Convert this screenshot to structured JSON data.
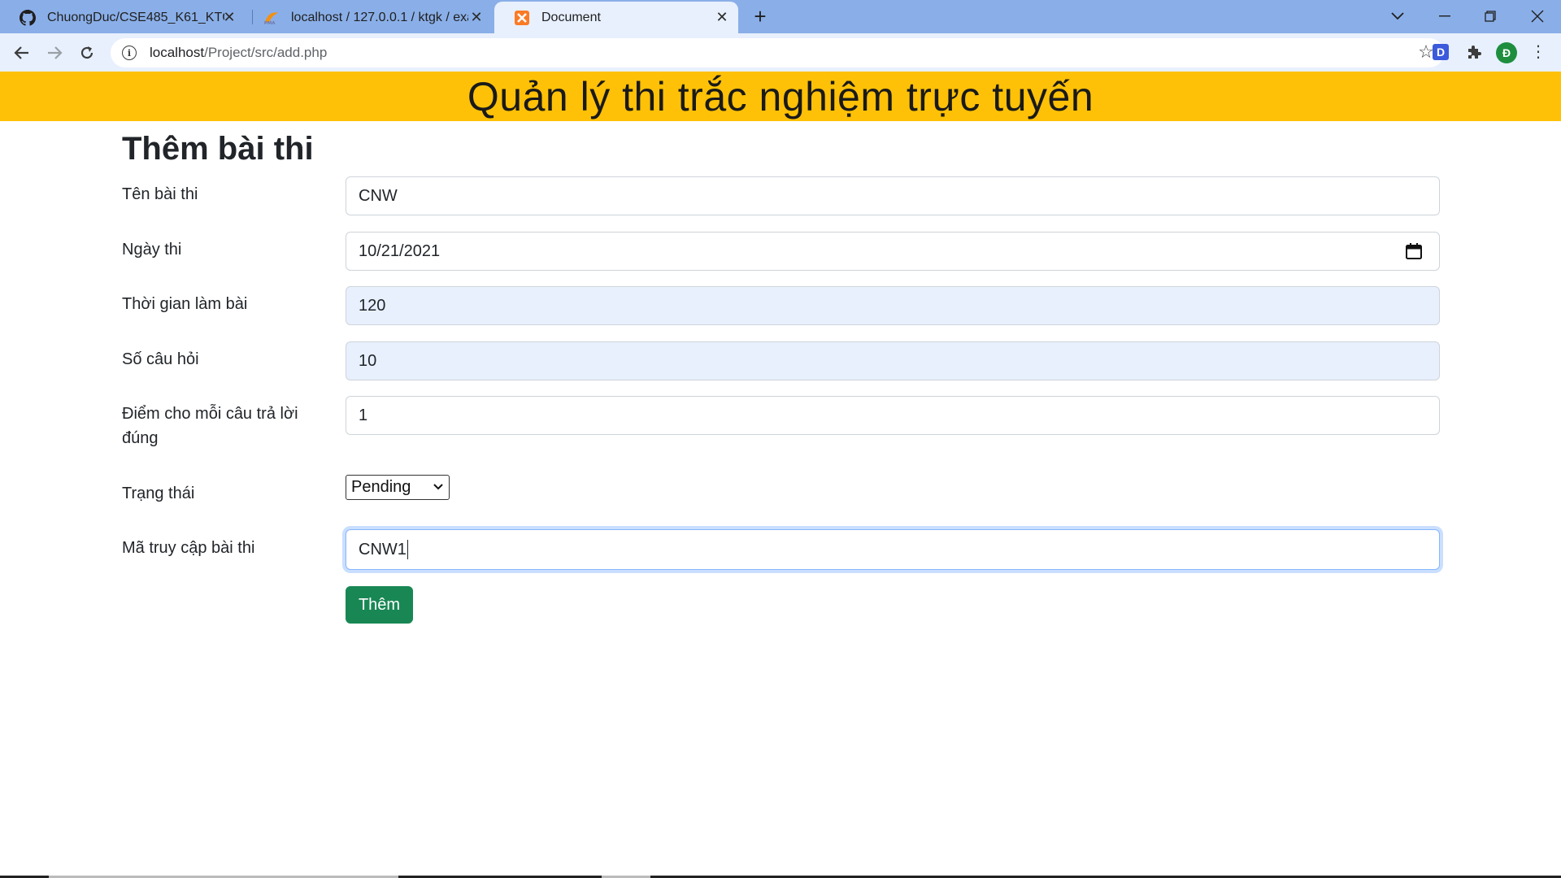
{
  "browser": {
    "tabs": [
      {
        "title": "ChuongDuc/CSE485_K61_KTGK_1",
        "icon": "github-icon",
        "active": false
      },
      {
        "title": "localhost / 127.0.0.1 / ktgk / exam",
        "icon": "phpmyadmin-icon",
        "active": false
      },
      {
        "title": "Document",
        "icon": "xampp-icon",
        "active": true
      }
    ],
    "url_host": "localhost",
    "url_path": "/Project/src/add.php",
    "profile_initial": "Đ",
    "extension_letter": "D"
  },
  "page": {
    "banner_title": "Quản lý thi trắc nghiệm trực tuyến",
    "heading": "Thêm bài thi",
    "form": {
      "exam_name_label": "Tên bài thi",
      "exam_name_value": "CNW",
      "exam_date_label": "Ngày thi",
      "exam_date_value": "10/21/2021",
      "duration_label": "Thời gian làm bài",
      "duration_value": "120",
      "question_count_label": "Số câu hỏi",
      "question_count_value": "10",
      "points_label": "Điểm cho mỗi câu trả lời đúng",
      "points_value": "1",
      "status_label": "Trạng thái",
      "status_value": "Pending",
      "access_code_label": "Mã truy cập bài thi",
      "access_code_value": "CNW1",
      "submit_label": "Thêm"
    }
  },
  "colors": {
    "banner": "#ffc107",
    "submit": "#198754",
    "autofill": "#e8f0fe",
    "tabstrip": "#8aafe8"
  }
}
